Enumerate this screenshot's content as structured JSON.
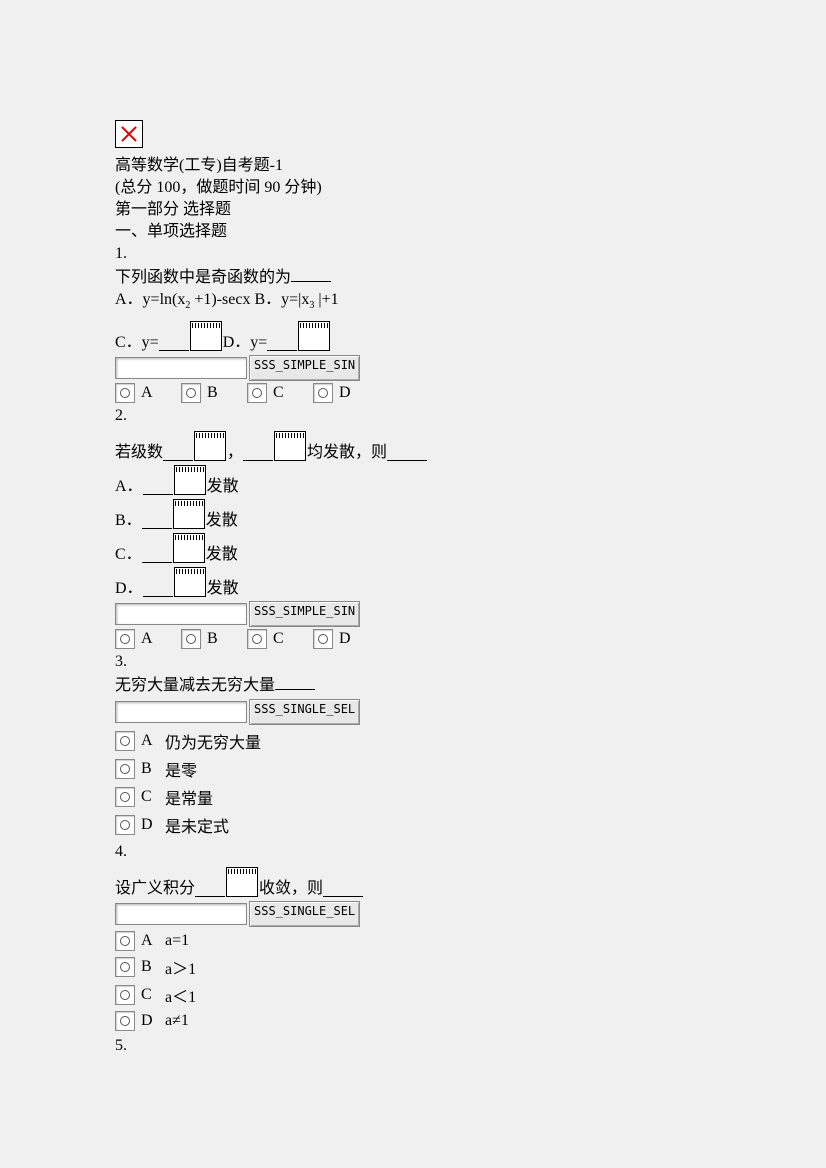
{
  "header": {
    "title": "高等数学(工专)自考题-1",
    "subtitle": "(总分 100，做题时间 90 分钟)",
    "part": "第一部分 选择题",
    "section": "一、单项选择题"
  },
  "buttons": {
    "simple": "SSS_SIMPLE_SIN",
    "single": "SSS_SINGLE_SEL"
  },
  "letters": {
    "a": "A",
    "b": "B",
    "c": "C",
    "d": "D"
  },
  "q1": {
    "num": "1.",
    "stem": "下列函数中是奇函数的为",
    "optA": "A．y=ln(x",
    "optA_exp": "2",
    "optA_after": " +1)-secx",
    "optB_pre": "B．y=|x",
    "optB_exp": "3",
    "optB_after": " |+1",
    "optC": "C．y=",
    "optD": "D．y="
  },
  "q2": {
    "num": "2.",
    "stem_pre": "若级数",
    "stem_mid": "，",
    "stem_after": "均发散，则",
    "optA": "A．",
    "optA_after": "发散",
    "optB": "B．",
    "optB_after": "发散",
    "optC": "C．",
    "optC_after": "发散",
    "optD": "D．",
    "optD_after": "发散"
  },
  "q3": {
    "num": "3.",
    "stem": "无穷大量减去无穷大量",
    "optA": "仍为无穷大量",
    "optB": "是零",
    "optC": "是常量",
    "optD": "是未定式"
  },
  "q4": {
    "num": "4.",
    "stem_pre": "设广义积分",
    "stem_after": "收敛，则",
    "optA": "a=1",
    "optB": "a＞1",
    "optC": "a＜1",
    "optD": "a≠1"
  },
  "q5": {
    "num": "5."
  }
}
